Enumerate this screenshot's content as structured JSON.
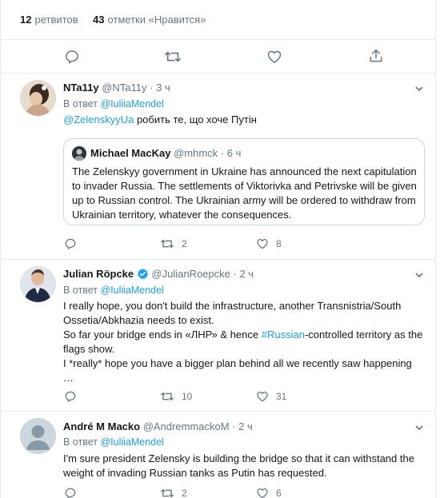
{
  "stats": {
    "retweets_count": "12",
    "retweets_label": "ретвитов",
    "likes_count": "43",
    "likes_label": "отметки «Нравится»"
  },
  "tweets": [
    {
      "name": "NTa11y",
      "handle": "@NTa11y",
      "sep": "·",
      "time": "3 ч",
      "reply_prefix": "В ответ",
      "reply_to": "@IuliiaMendel",
      "mention": "@ZelenskyyUa",
      "text": " робить те, що хоче Путін",
      "quote": {
        "name": "Michael MacKay",
        "handle": "@mhmck",
        "sep": "·",
        "time": "6 ч",
        "text": "The Zelenskyy government in Ukraine has announced the next capitulation to invader Russia. The settlements of Viktorivka and Petrivske will be given up to Russian control. The Ukrainian army will be ordered to withdraw from Ukrainian territory, whatever the consequences."
      },
      "actions": {
        "reply": "",
        "retweet": "2",
        "like": "8"
      }
    },
    {
      "name": "Julian Röpcke",
      "handle": "@JulianRoepcke",
      "sep": "·",
      "time": "2 ч",
      "reply_prefix": "В ответ",
      "reply_to": "@IuliiaMendel",
      "line1": "I really hope, you don't build the infrastructure, another Transnistria/South Ossetia/Abkhazia needs to exist.",
      "line2a": "So far your bridge ends in «ЛНР» & hence ",
      "line2_hashtag": "#Russian",
      "line2b": "-controlled territory as the flags show.",
      "line3": "I *really* hope you have a bigger plan behind all we recently saw happening …",
      "actions": {
        "reply": "",
        "retweet": "10",
        "like": "31"
      }
    },
    {
      "name": "André M Macko",
      "handle": "@AndremmackoM",
      "sep": "·",
      "time": "2 ч",
      "reply_prefix": "В ответ",
      "reply_to": "@IuliiaMendel",
      "text": "I'm sure president Zelensky is building the bridge so that it can withstand the weight of invading Russian tanks as Putin has requested.",
      "actions": {
        "reply": "",
        "retweet": "2",
        "like": "6"
      }
    }
  ],
  "colors": {
    "link": "#1da1f2",
    "secondary": "#657786",
    "border": "#e6ecf0",
    "verified": "#1da1f2"
  },
  "icons": [
    "reply-icon",
    "retweet-icon",
    "like-icon",
    "share-icon",
    "chevron-down-icon",
    "verified-badge-icon"
  ]
}
